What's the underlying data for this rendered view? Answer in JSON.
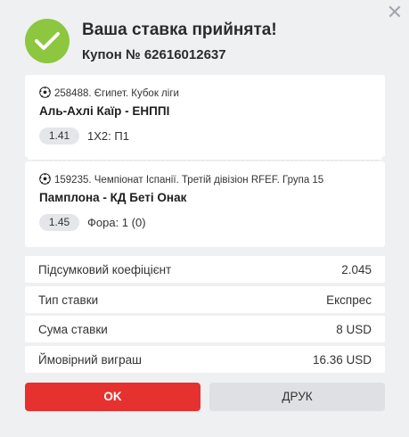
{
  "dialog": {
    "title": "Ваша ставка прийнята!",
    "coupon": "Купон № 62616012637",
    "close_symbol": "✕"
  },
  "bets": [
    {
      "league": "258488. Єгипет. Кубок ліги",
      "match": "Аль-Ахлі Каїр - ЕНППІ",
      "odd": "1.41",
      "market": "1X2: П1"
    },
    {
      "league": "159235. Чемпіонат Іспанії. Третій дівізіон RFEF. Група 15",
      "match": "Памплона - КД Беті Онак",
      "odd": "1.45",
      "market": "Фора: 1 (0)"
    }
  ],
  "summary": [
    {
      "label": "Підсумковий коефіцієнт",
      "value": "2.045"
    },
    {
      "label": "Тип ставки",
      "value": "Експрес"
    },
    {
      "label": "Сума ставки",
      "value": "8 USD"
    },
    {
      "label": "Ймовірний виграш",
      "value": "16.36 USD"
    }
  ],
  "buttons": {
    "ok": "OK",
    "print": "ДРУК"
  },
  "colors": {
    "accent_red": "#e6322f",
    "success_green": "#8dc63f",
    "background": "#eff0f2"
  },
  "icons": {
    "success": "check-icon",
    "sport": "soccer-ball-icon",
    "close": "close-icon"
  }
}
